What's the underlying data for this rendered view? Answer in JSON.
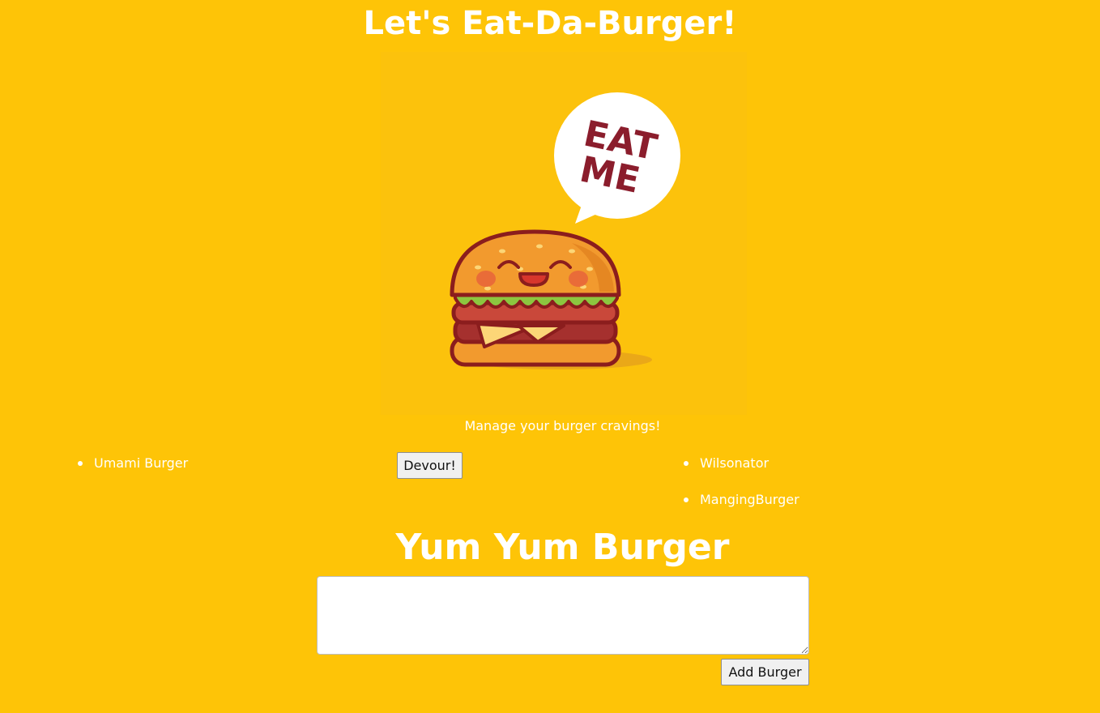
{
  "header": {
    "title": "Let's Eat-Da-Burger!"
  },
  "hero": {
    "bubble_text_line1": "EAT",
    "bubble_text_line2": "ME",
    "tagline": "Manage your burger cravings!"
  },
  "not_devoured": {
    "items": [
      {
        "name": "Umami Burger",
        "button_label": "Devour!"
      }
    ]
  },
  "devoured": {
    "items": [
      {
        "name": "Wilsonator"
      },
      {
        "name": "MangingBurger"
      }
    ]
  },
  "form": {
    "title": "Yum Yum Burger",
    "input_value": "",
    "submit_label": "Add Burger"
  },
  "colors": {
    "background": "#fec407",
    "text": "#ffffff",
    "bubble_text": "#8b1d2c",
    "bun": "#f29a2e",
    "lettuce": "#8cc63f",
    "patty": "#a5302e",
    "cheese": "#fcd677",
    "outline": "#8b1d1d"
  }
}
